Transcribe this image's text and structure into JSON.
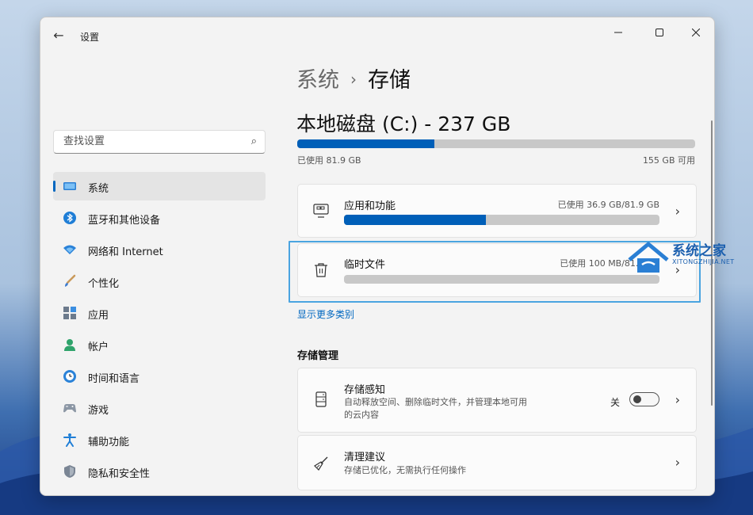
{
  "window": {
    "title": "设置"
  },
  "search": {
    "placeholder": "查找设置"
  },
  "sidebar": {
    "items": [
      {
        "label": "系统",
        "icon": "system-icon",
        "selected": true
      },
      {
        "label": "蓝牙和其他设备",
        "icon": "bluetooth-icon"
      },
      {
        "label": "网络和 Internet",
        "icon": "wifi-icon"
      },
      {
        "label": "个性化",
        "icon": "brush-icon"
      },
      {
        "label": "应用",
        "icon": "apps-icon"
      },
      {
        "label": "帐户",
        "icon": "account-icon"
      },
      {
        "label": "时间和语言",
        "icon": "clock-globe-icon"
      },
      {
        "label": "游戏",
        "icon": "gamepad-icon"
      },
      {
        "label": "辅助功能",
        "icon": "accessibility-icon"
      },
      {
        "label": "隐私和安全性",
        "icon": "shield-icon"
      }
    ]
  },
  "breadcrumb": {
    "parent": "系统",
    "separator": "›",
    "current": "存储"
  },
  "disk": {
    "title": "本地磁盘 (C:) - 237 GB",
    "used_label": "已使用 81.9 GB",
    "free_label": "155 GB 可用",
    "used_fraction": 0.345
  },
  "categories": [
    {
      "title": "应用和功能",
      "usage": "已使用 36.9 GB/81.9 GB",
      "fraction": 0.45,
      "icon": "apps-features-icon"
    },
    {
      "title": "临时文件",
      "usage": "已使用 100 MB/81.9 GB",
      "fraction": 0.0,
      "icon": "trash-icon"
    }
  ],
  "more_link": "显示更多类别",
  "management": {
    "heading": "存储管理",
    "storage_sense": {
      "title": "存储感知",
      "description": "自动释放空间、删除临时文件，并管理本地可用的云内容",
      "toggle_label": "关",
      "toggle_on": false
    },
    "cleanup": {
      "title": "清理建议",
      "description": "存储已优化，无需执行任何操作"
    }
  },
  "watermark": {
    "title": "系统之家",
    "subtitle": "XITONGZHIJIA.NET"
  },
  "colors": {
    "accent": "#005fb8",
    "highlight": "#4aa4e0",
    "bar_bg": "#c8c8c8"
  }
}
